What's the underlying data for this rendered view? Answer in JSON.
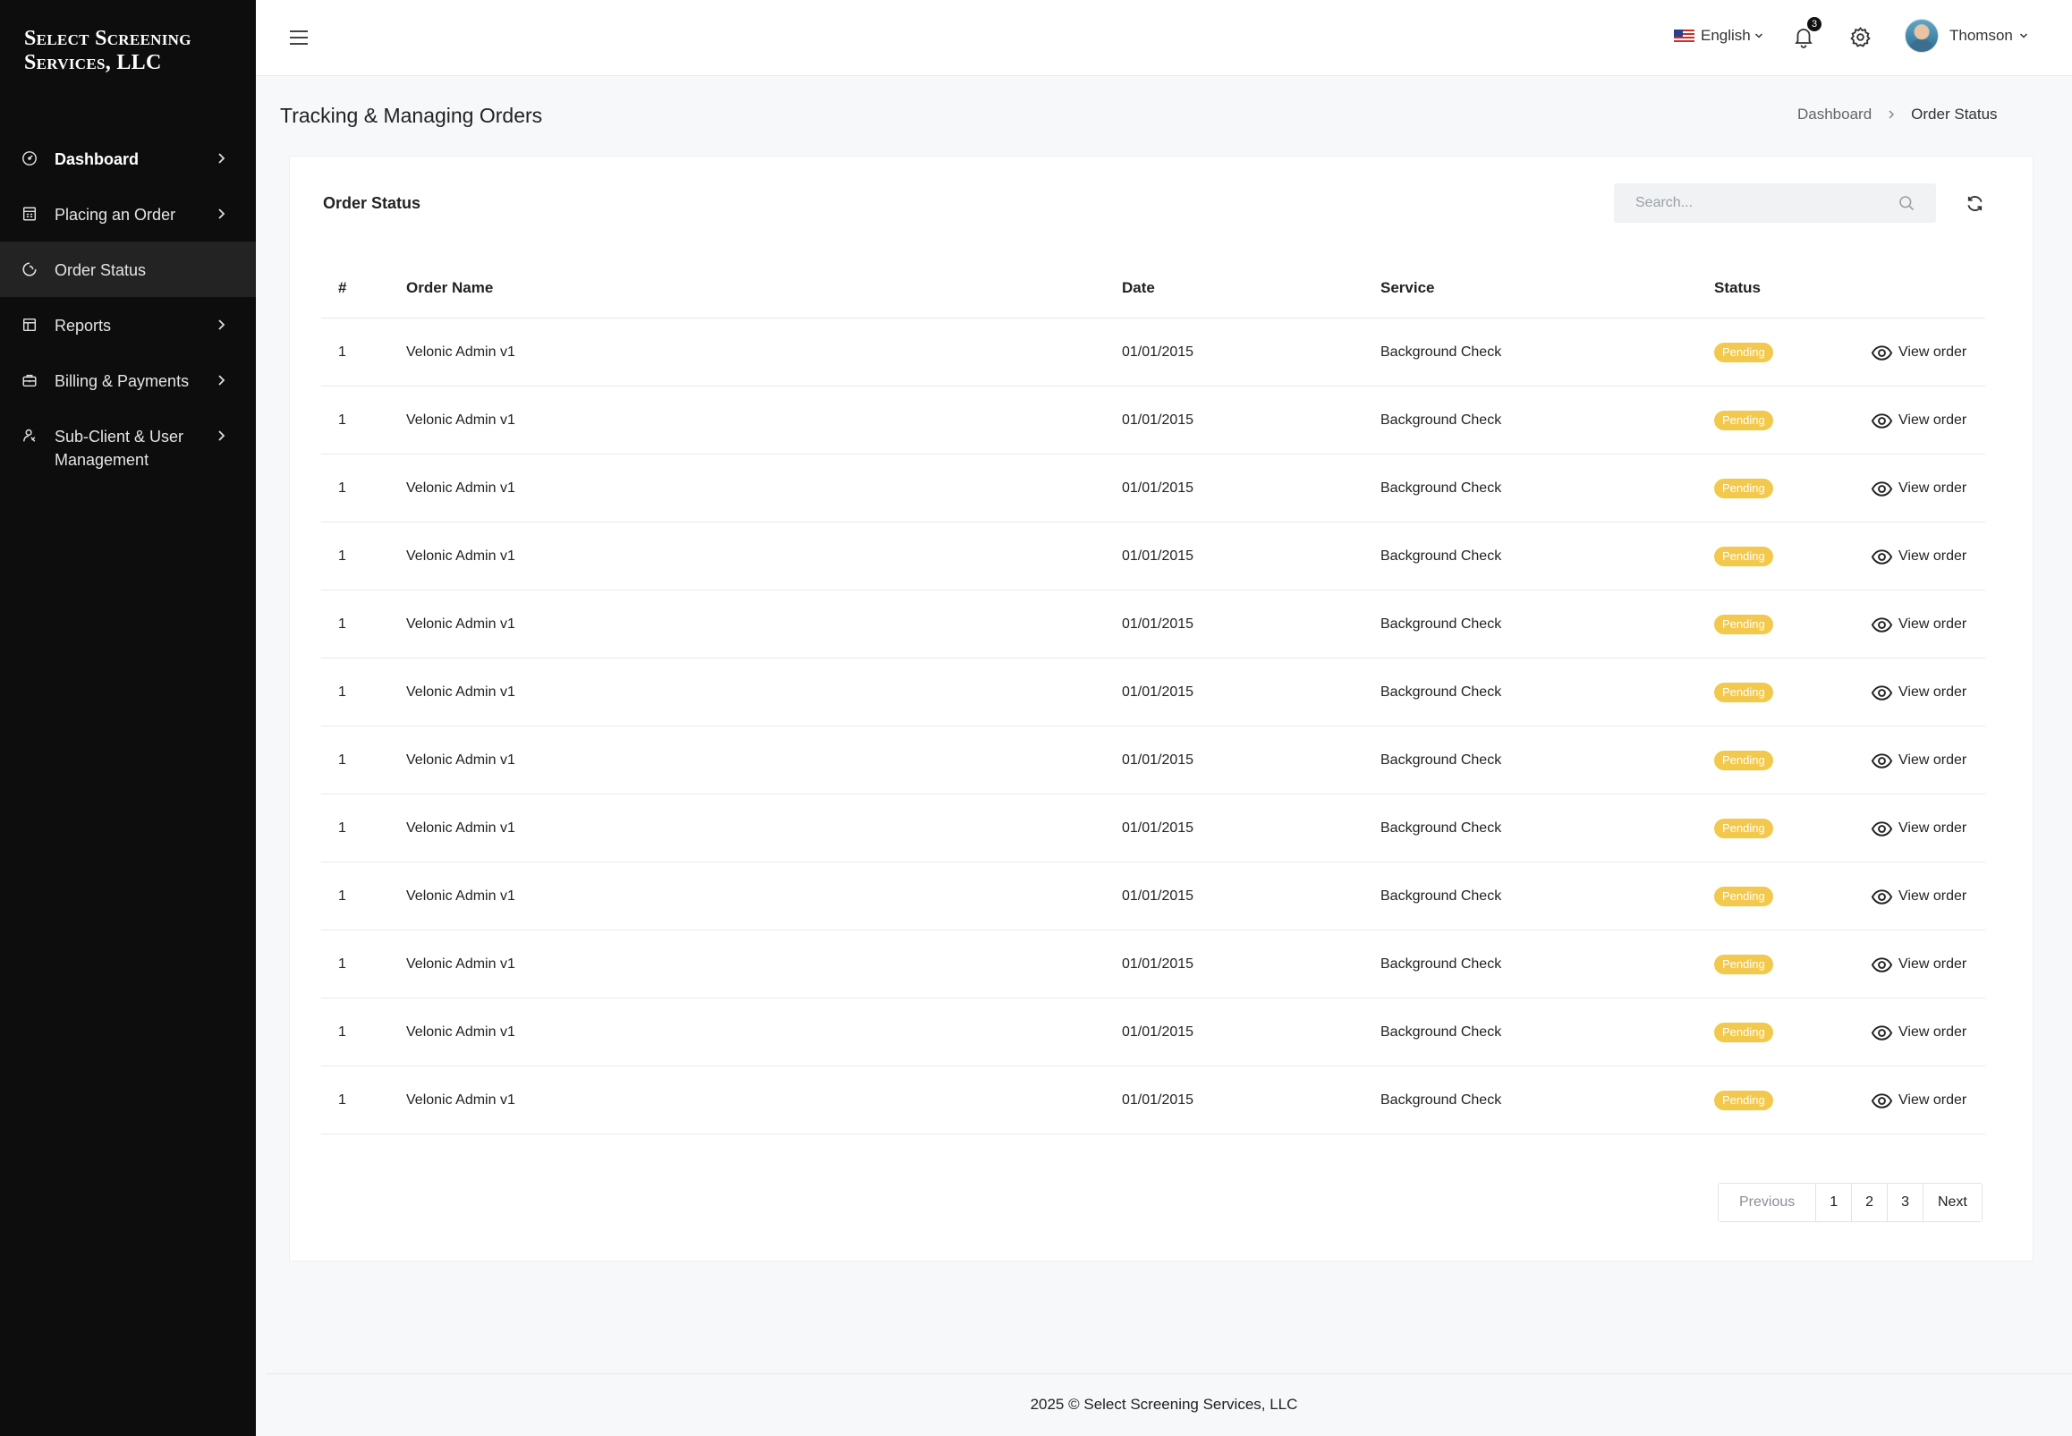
{
  "brand": {
    "name": "Select Screening Services, LLC"
  },
  "sidebar": {
    "items": [
      {
        "label": "Dashboard",
        "icon": "gauge-icon",
        "has_chevron": true,
        "bold": true
      },
      {
        "label": "Placing an Order",
        "icon": "order-form-icon",
        "has_chevron": true
      },
      {
        "label": "Order Status",
        "icon": "status-circle-icon",
        "has_chevron": false,
        "active": true
      },
      {
        "label": "Reports",
        "icon": "report-icon",
        "has_chevron": true
      },
      {
        "label": "Billing & Payments",
        "icon": "briefcase-icon",
        "has_chevron": true
      },
      {
        "label": "Sub-Client & User Management",
        "icon": "user-management-icon",
        "has_chevron": true
      }
    ]
  },
  "topbar": {
    "language": "English",
    "notifications_count": "3",
    "user_name": "Thomson"
  },
  "page": {
    "title": "Tracking & Managing Orders",
    "breadcrumb": [
      "Dashboard",
      "Order Status"
    ]
  },
  "card": {
    "title": "Order Status",
    "search_placeholder": "Search..."
  },
  "table": {
    "columns": [
      "#",
      "Order Name",
      "Date",
      "Service",
      "Status"
    ],
    "rows": [
      {
        "num": "1",
        "name": "Velonic Admin v1",
        "date": "01/01/2015",
        "service": "Background Check",
        "status": "Pending",
        "action": "View order"
      },
      {
        "num": "1",
        "name": "Velonic Admin v1",
        "date": "01/01/2015",
        "service": "Background Check",
        "status": "Pending",
        "action": "View order"
      },
      {
        "num": "1",
        "name": "Velonic Admin v1",
        "date": "01/01/2015",
        "service": "Background Check",
        "status": "Pending",
        "action": "View order"
      },
      {
        "num": "1",
        "name": "Velonic Admin v1",
        "date": "01/01/2015",
        "service": "Background Check",
        "status": "Pending",
        "action": "View order"
      },
      {
        "num": "1",
        "name": "Velonic Admin v1",
        "date": "01/01/2015",
        "service": "Background Check",
        "status": "Pending",
        "action": "View order"
      },
      {
        "num": "1",
        "name": "Velonic Admin v1",
        "date": "01/01/2015",
        "service": "Background Check",
        "status": "Pending",
        "action": "View order"
      },
      {
        "num": "1",
        "name": "Velonic Admin v1",
        "date": "01/01/2015",
        "service": "Background Check",
        "status": "Pending",
        "action": "View order"
      },
      {
        "num": "1",
        "name": "Velonic Admin v1",
        "date": "01/01/2015",
        "service": "Background Check",
        "status": "Pending",
        "action": "View order"
      },
      {
        "num": "1",
        "name": "Velonic Admin v1",
        "date": "01/01/2015",
        "service": "Background Check",
        "status": "Pending",
        "action": "View order"
      },
      {
        "num": "1",
        "name": "Velonic Admin v1",
        "date": "01/01/2015",
        "service": "Background Check",
        "status": "Pending",
        "action": "View order"
      },
      {
        "num": "1",
        "name": "Velonic Admin v1",
        "date": "01/01/2015",
        "service": "Background Check",
        "status": "Pending",
        "action": "View order"
      },
      {
        "num": "1",
        "name": "Velonic Admin v1",
        "date": "01/01/2015",
        "service": "Background Check",
        "status": "Pending",
        "action": "View order"
      }
    ]
  },
  "pagination": {
    "previous": "Previous",
    "pages": [
      "1",
      "2",
      "3"
    ],
    "next": "Next"
  },
  "footer": {
    "text": "2025 © Select Screening Services, LLC"
  },
  "colors": {
    "sidebar_bg": "#0d0d0d",
    "pending": "#f2c94c",
    "page_bg": "#f7f8fa"
  }
}
